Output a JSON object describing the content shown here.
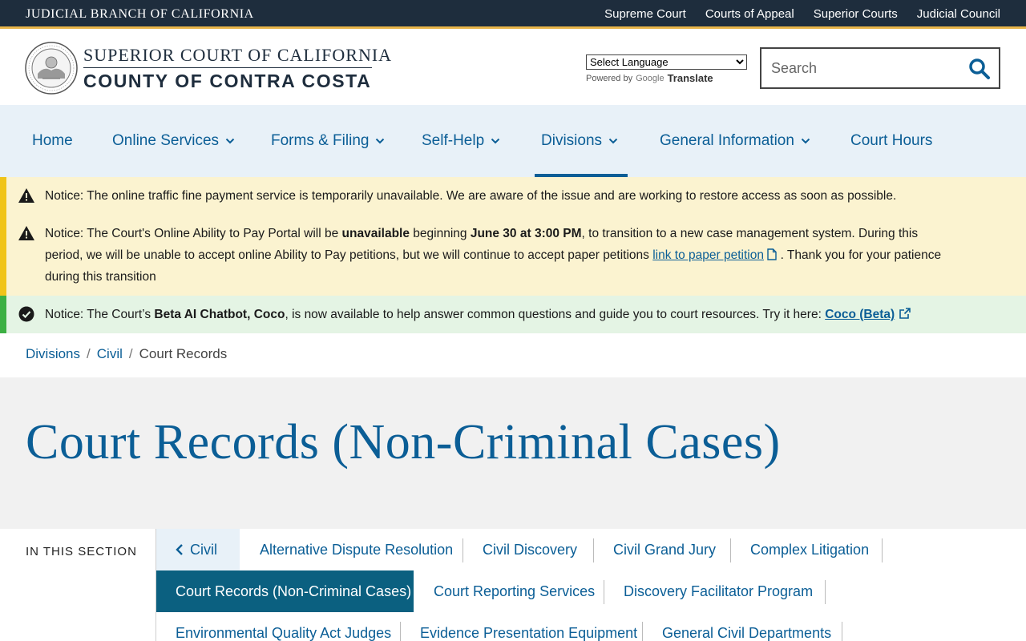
{
  "topbar": {
    "brand": "JUDICIAL BRANCH OF CALIFORNIA",
    "links": [
      "Supreme Court",
      "Courts of Appeal",
      "Superior Courts",
      "Judicial Council"
    ]
  },
  "header": {
    "seal_text": "JUDICIAL BRANCH OF CALIFORNIA",
    "title_line1": "SUPERIOR COURT OF CALIFORNIA",
    "title_line2": "COUNTY OF CONTRA COSTA"
  },
  "language": {
    "selected": "Select Language",
    "powered_by": "Powered by",
    "google": "Google",
    "translate": "Translate"
  },
  "search": {
    "placeholder": "Search"
  },
  "nav": {
    "items": [
      {
        "label": "Home",
        "has_menu": false
      },
      {
        "label": "Online Services",
        "has_menu": true
      },
      {
        "label": "Forms & Filing",
        "has_menu": true
      },
      {
        "label": "Self-Help",
        "has_menu": true
      },
      {
        "label": "Divisions",
        "has_menu": true,
        "active": true
      },
      {
        "label": "General Information",
        "has_menu": true
      },
      {
        "label": "Court Hours",
        "has_menu": false
      }
    ]
  },
  "notices": {
    "n1": "Notice: The online traffic fine payment service is temporarily unavailable. We are aware of the issue and are working to restore access as soon as possible.",
    "n2_a": "Notice: The Court's Online Ability to Pay Portal will be ",
    "n2_b": "unavailable",
    "n2_c": " beginning ",
    "n2_d": "June 30 at 3:00 PM",
    "n2_e": ", to transition to a new case management system. During this period, we will be unable to accept online Ability to Pay petitions, but we will continue to accept paper petitions ",
    "n2_link": "link to paper petition",
    "n2_f": " . Thank you for your patience during this transition",
    "n3_a": "Notice: The Court’s ",
    "n3_b": "Beta AI Chatbot, Coco",
    "n3_c": ", is now available to help answer common questions and guide you to court resources. Try it here: ",
    "n3_link": "Coco (Beta)"
  },
  "breadcrumb": {
    "items": [
      "Divisions",
      "Civil"
    ],
    "current": "Court Records"
  },
  "page": {
    "title": "Court Records (Non-Criminal Cases)"
  },
  "section": {
    "label": "IN THIS SECTION",
    "back": "Civil",
    "links": [
      "Alternative Dispute Resolution",
      "Civil Discovery",
      "Civil Grand Jury",
      "Complex Litigation",
      "Court Records (Non-Criminal Cases)",
      "Court Reporting Services",
      "Discovery Facilitator Program",
      "Environmental Quality Act Judges",
      "Evidence Presentation Equipment",
      "General Civil Departments"
    ]
  },
  "colors": {
    "primary": "#0b5e96",
    "topbar": "#1e2d3d",
    "accent": "#e8b54a",
    "warn_bg": "#fbf3d0",
    "ok_bg": "#e4f4e4"
  }
}
